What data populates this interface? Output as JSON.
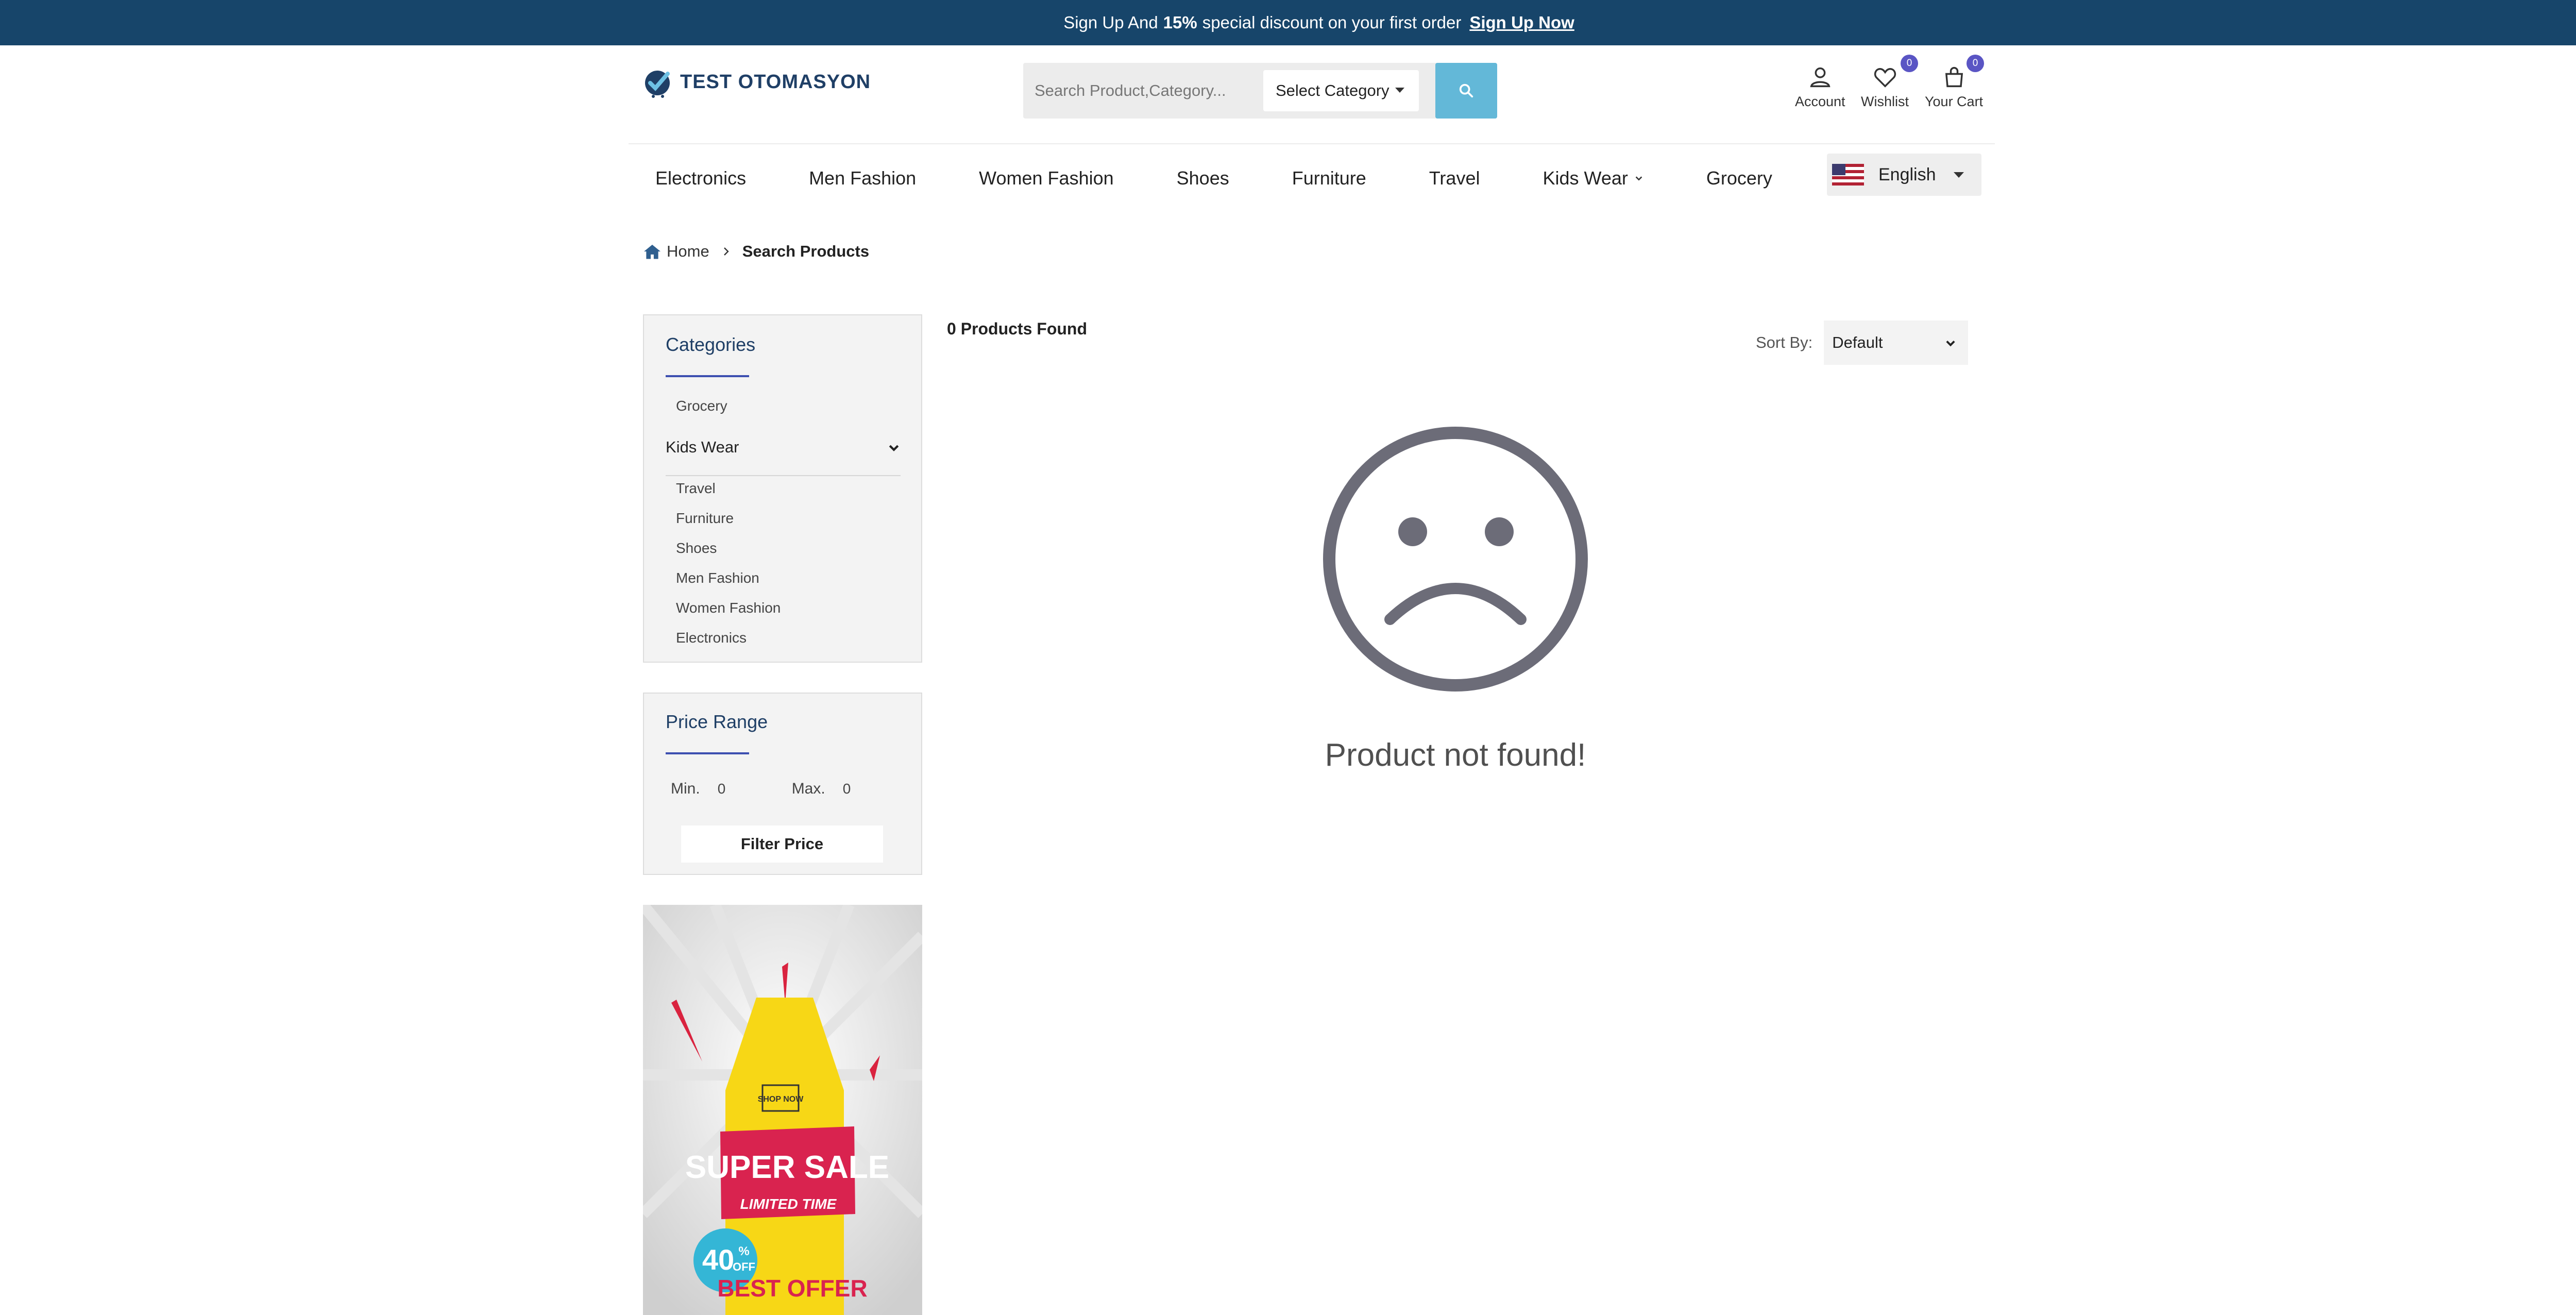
{
  "topbar": {
    "prefix": "Sign Up And",
    "discount": "15%",
    "suffix": "special discount on your first order",
    "link": "Sign Up Now"
  },
  "brand": {
    "name": "TEST OTOMASYON"
  },
  "search": {
    "placeholder": "Search Product,Category...",
    "category_label": "Select Category",
    "button_icon": "search-icon"
  },
  "header_actions": {
    "account": {
      "label": "Account",
      "icon": "user-icon"
    },
    "wishlist": {
      "label": "Wishlist",
      "icon": "heart-icon",
      "count": "0"
    },
    "cart": {
      "label": "Your Cart",
      "icon": "bag-icon",
      "count": "0"
    }
  },
  "nav": {
    "items": [
      "Electronics",
      "Men Fashion",
      "Women Fashion",
      "Shoes",
      "Furniture",
      "Travel",
      "Kids Wear",
      "Grocery"
    ],
    "language": "English"
  },
  "breadcrumb": {
    "home": "Home",
    "current": "Search Products"
  },
  "sidebar": {
    "categories_title": "Categories",
    "top_item": "Grocery",
    "expanded": "Kids Wear",
    "items": [
      "Travel",
      "Furniture",
      "Shoes",
      "Men Fashion",
      "Women Fashion",
      "Electronics"
    ],
    "price_title": "Price Range",
    "min_label": "Min.",
    "min_value": "0",
    "max_label": "Max.",
    "max_value": "0",
    "filter_button": "Filter Price"
  },
  "banner": {
    "shop_now": "SHOP NOW",
    "headline": "SUPER SALE",
    "subline": "LIMITED TIME",
    "badge_percent": "40",
    "badge_symbol": "%",
    "badge_off": "OFF",
    "best_offer": "BEST OFFER"
  },
  "results": {
    "count_text": "0 Products Found",
    "sort_label": "Sort By:",
    "sort_value": "Default",
    "empty_icon": "sad-face-icon",
    "empty_message": "Product not found!"
  },
  "colors": {
    "topbar": "#17456a",
    "accent": "#63b8d8",
    "badge": "#5a55c4",
    "panel_title": "#1f3f66",
    "sad_face": "#6c6c78"
  }
}
